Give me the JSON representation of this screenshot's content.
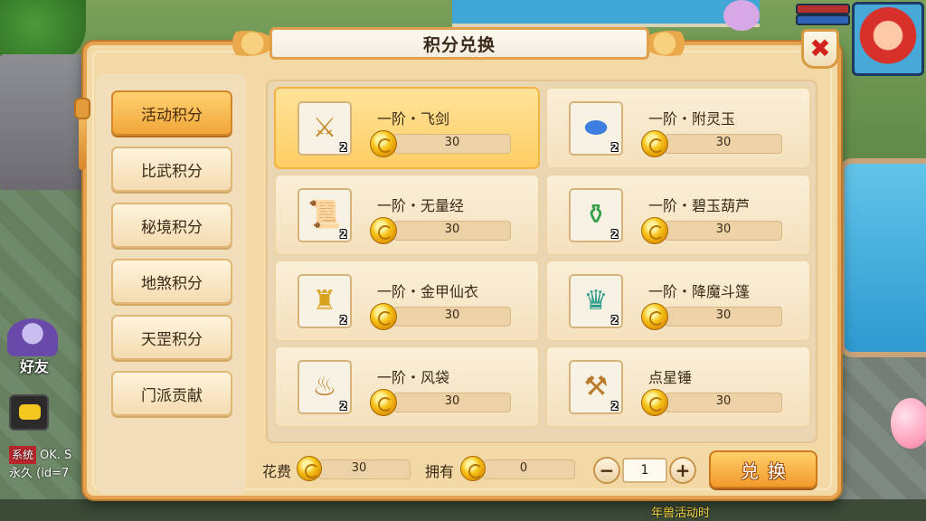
{
  "dialog": {
    "title": "积分兑换",
    "close_icon": "✖"
  },
  "categories": [
    {
      "label": "活动积分",
      "active": true
    },
    {
      "label": "比武积分",
      "active": false
    },
    {
      "label": "秘境积分",
      "active": false
    },
    {
      "label": "地煞积分",
      "active": false
    },
    {
      "label": "天罡积分",
      "active": false
    },
    {
      "label": "门派贡献",
      "active": false
    }
  ],
  "items": [
    {
      "name": "一阶・飞剑",
      "count": "2",
      "price": "30",
      "icon": "sword-icon",
      "glyph": "⚔",
      "color": "#c48a2a",
      "selected": true
    },
    {
      "name": "一阶・附灵玉",
      "count": "2",
      "price": "30",
      "icon": "jade-icon",
      "glyph": "⬬",
      "color": "#3d7fe0",
      "selected": false
    },
    {
      "name": "一阶・无量经",
      "count": "2",
      "price": "30",
      "icon": "scroll-icon",
      "glyph": "📜",
      "color": "#c2452a",
      "selected": false
    },
    {
      "name": "一阶・碧玉葫芦",
      "count": "2",
      "price": "30",
      "icon": "gourd-icon",
      "glyph": "⚱",
      "color": "#2fa046",
      "selected": false
    },
    {
      "name": "一阶・金甲仙衣",
      "count": "2",
      "price": "30",
      "icon": "armor-icon",
      "glyph": "♜",
      "color": "#d8a11e",
      "selected": false
    },
    {
      "name": "一阶・降魔斗篷",
      "count": "2",
      "price": "30",
      "icon": "cloak-icon",
      "glyph": "♛",
      "color": "#2f9d8a",
      "selected": false
    },
    {
      "name": "一阶・风袋",
      "count": "2",
      "price": "30",
      "icon": "wind-bag-icon",
      "glyph": "♨",
      "color": "#c27a2a",
      "selected": false
    },
    {
      "name": "点星锤",
      "count": "2",
      "price": "30",
      "icon": "hammer-icon",
      "glyph": "⚒",
      "color": "#b97a2e",
      "selected": false
    }
  ],
  "footer": {
    "cost_label": "花费",
    "cost_value": "30",
    "own_label": "拥有",
    "own_value": "0",
    "quantity": "1",
    "minus": "−",
    "plus": "+",
    "exchange_label": "兑换"
  },
  "hud": {
    "friend_label": "好友",
    "chat_system_tag": "系统",
    "chat_line1": "OK. S",
    "chat_line2": "永久 (id=7",
    "bottom_text": "年兽活动时"
  },
  "colors": {
    "accent": "#f1a63a",
    "frame": "#e6a24e",
    "close_red": "#d4221f"
  }
}
